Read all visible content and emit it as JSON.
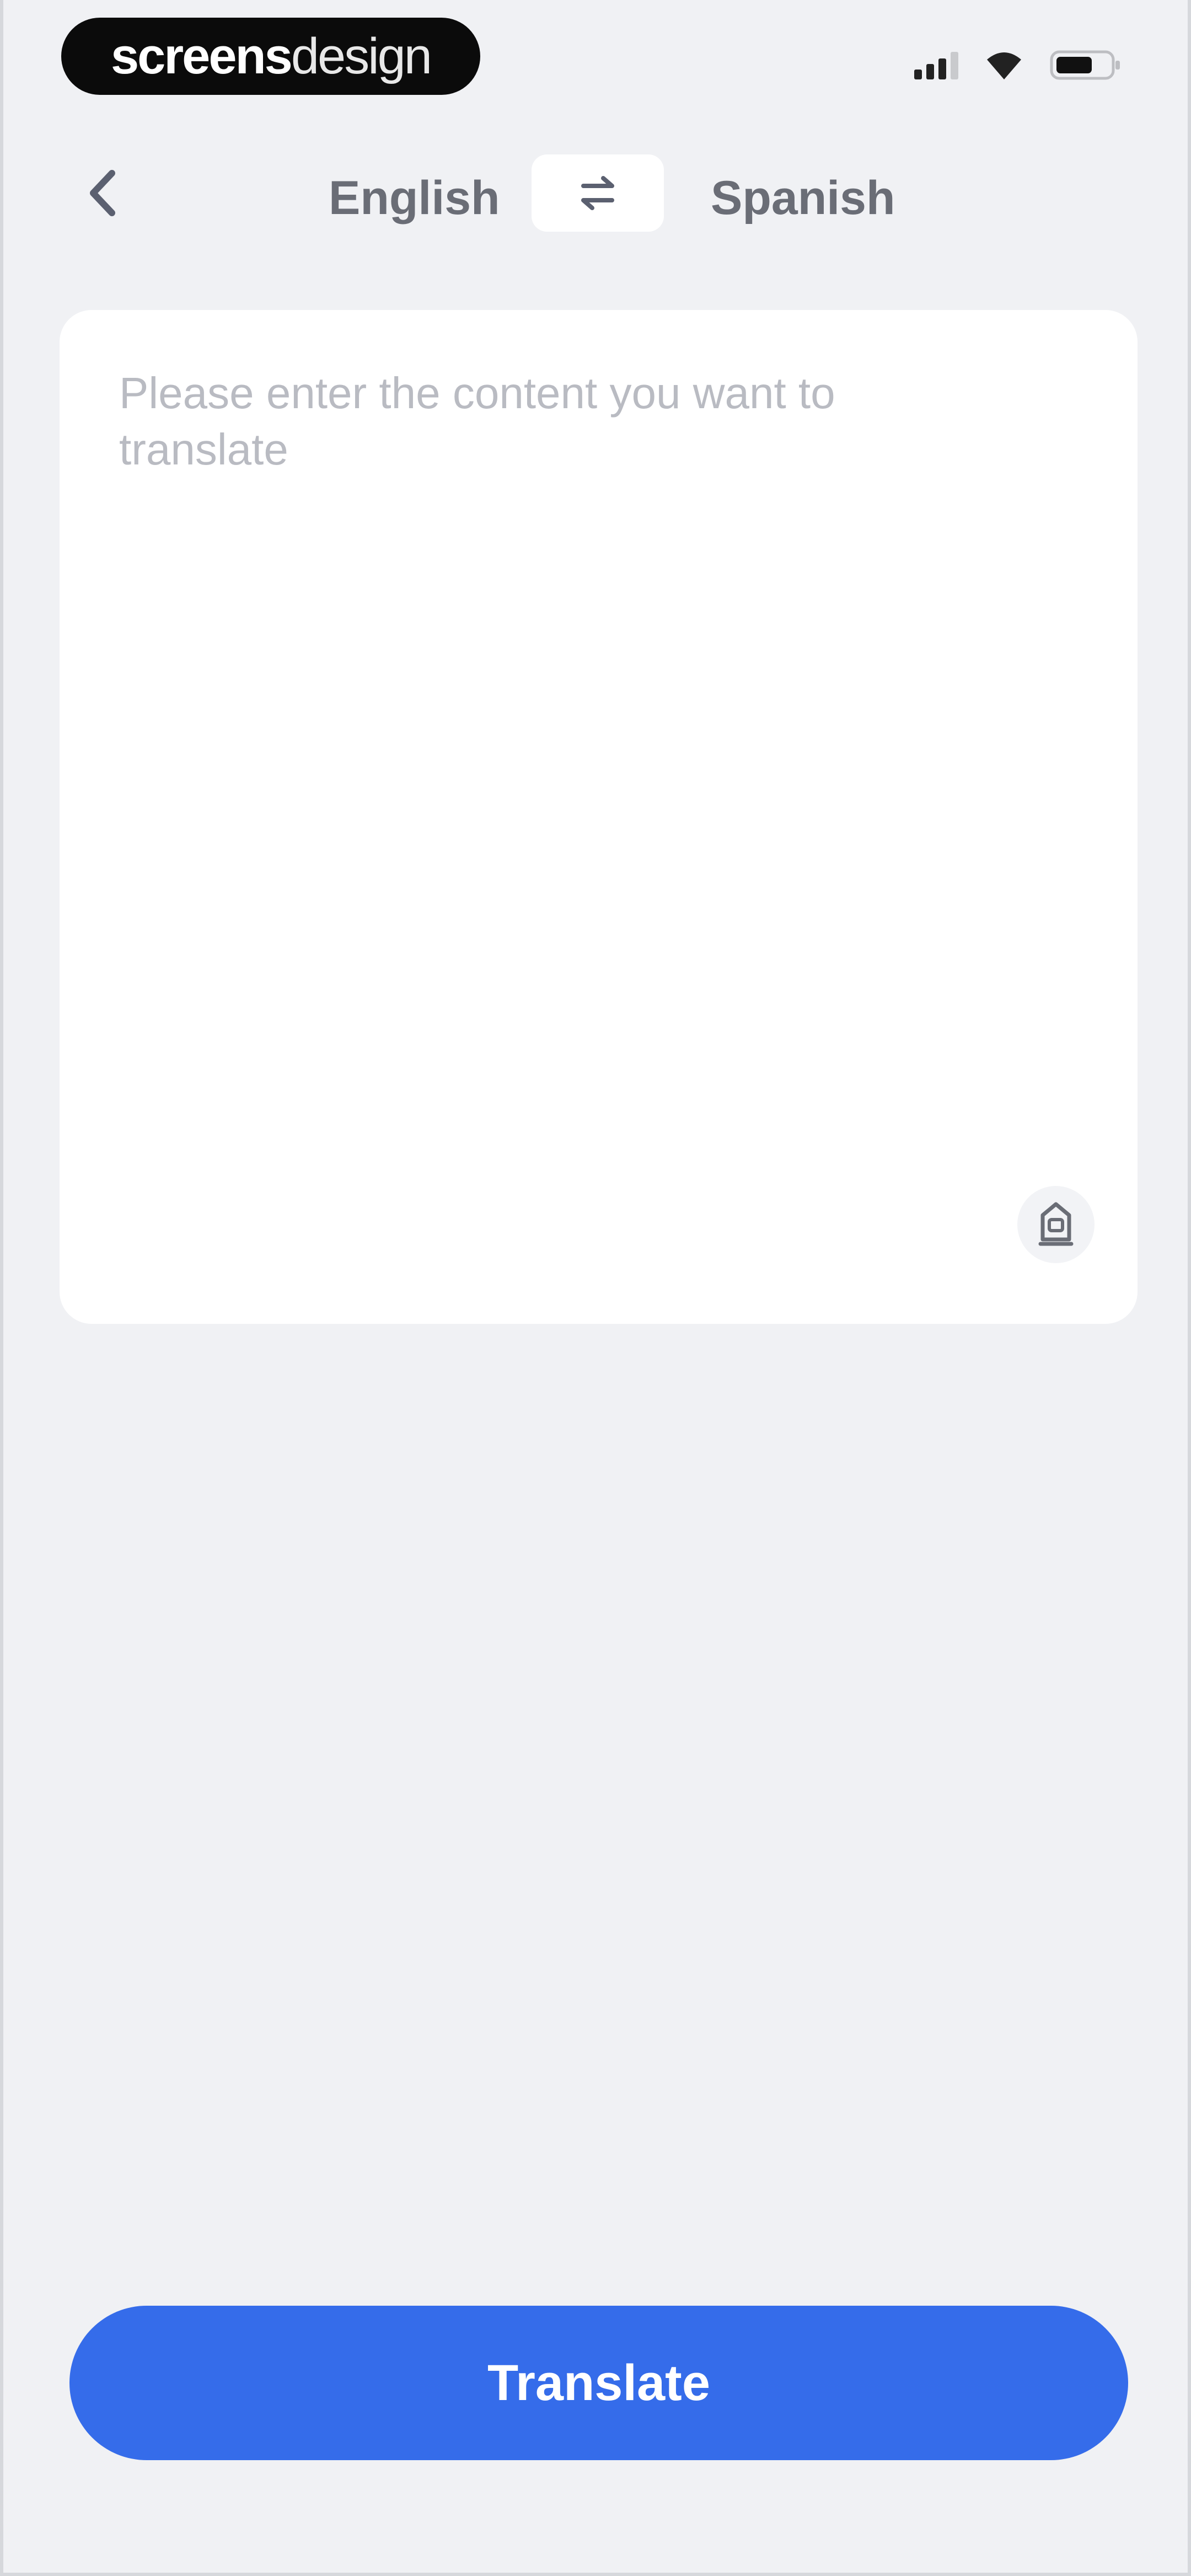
{
  "status_bar": {
    "brand_strong": "screens",
    "brand_light": "design",
    "icons": [
      "signal-icon",
      "wifi-icon",
      "battery-icon"
    ]
  },
  "header": {
    "back_icon": "chevron-left-icon",
    "source_language": "English",
    "target_language": "Spanish",
    "swap_icon": "swap-arrows-icon"
  },
  "input": {
    "placeholder": "Please enter the content you want to translate",
    "value": "",
    "action_icon": "microphone-icon"
  },
  "actions": {
    "translate_label": "Translate"
  },
  "colors": {
    "background": "#f0f1f4",
    "card": "#ffffff",
    "primary": "#356cea",
    "label_gray": "#6a6d76",
    "placeholder_gray": "#b9bbc2"
  }
}
